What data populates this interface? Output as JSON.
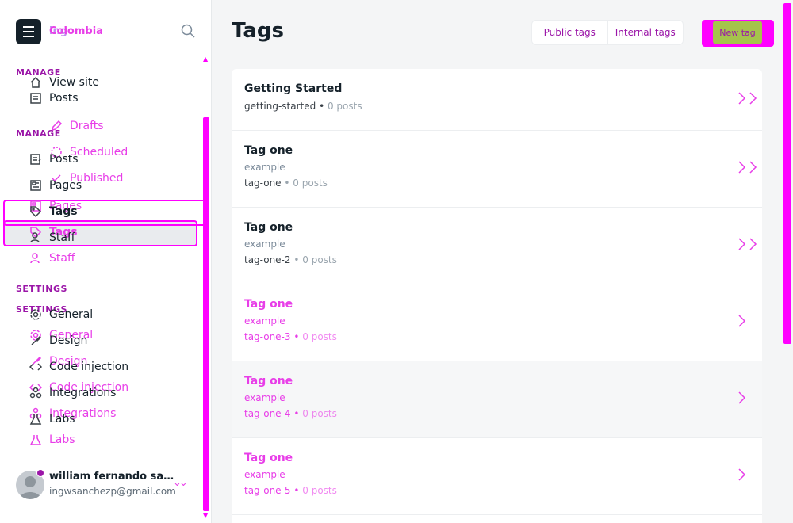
{
  "sidebar": {
    "brand_name": "Colombia",
    "brand_ghost": "ing",
    "sections": {
      "manage_a": "MANAGE",
      "manage_b": "MANAGE",
      "settings_a": "SETTINGS",
      "settings_b": "SETTINGS"
    },
    "view_site": "View site",
    "posts_a": "Posts",
    "drafts": "Drafts",
    "scheduled": "Scheduled",
    "published": "Published",
    "posts_b": "Posts",
    "pages_a": "Pages",
    "pages_b": "Pages",
    "tags_a": "Tags",
    "tags_b": "Tags",
    "staff_a": "Staff",
    "staff_b": "Staff",
    "general_a": "General",
    "general_b": "General",
    "design_a": "Design",
    "design_b": "Design",
    "code_a": "Code injection",
    "code_b": "Code injection",
    "integrations_a": "Integrations",
    "integrations_b": "Integrations",
    "labs_a": "Labs",
    "labs_b": "Labs"
  },
  "user": {
    "name": "william fernando san...",
    "email": "ingwsanchezp@gmail.com"
  },
  "header": {
    "title": "Tags",
    "tab_public": "Public tags",
    "tab_internal": "Internal tags",
    "new_tag": "New tag"
  },
  "tags": [
    {
      "title": "Getting Started",
      "description": "",
      "slug": "getting-started",
      "count": "0 posts"
    },
    {
      "title": "Tag one",
      "description": "example",
      "slug": "tag-one",
      "count": "0 posts"
    },
    {
      "title": "Tag one",
      "description": "example",
      "slug": "tag-one-2",
      "count": "0 posts"
    },
    {
      "title": "Tag one",
      "description": "example",
      "slug": "tag-one-3",
      "count": "0 posts"
    },
    {
      "title": "Tag one",
      "description": "example",
      "slug": "tag-one-4",
      "count": "0 posts"
    },
    {
      "title": "Tag one",
      "description": "example",
      "slug": "tag-one-5",
      "count": "0 posts"
    }
  ],
  "colors": {
    "accent": "#ff00ff",
    "accent_text": "#e83ee8",
    "section_title": "#9b16a8",
    "new_tag_inner": "#a5c34c"
  }
}
